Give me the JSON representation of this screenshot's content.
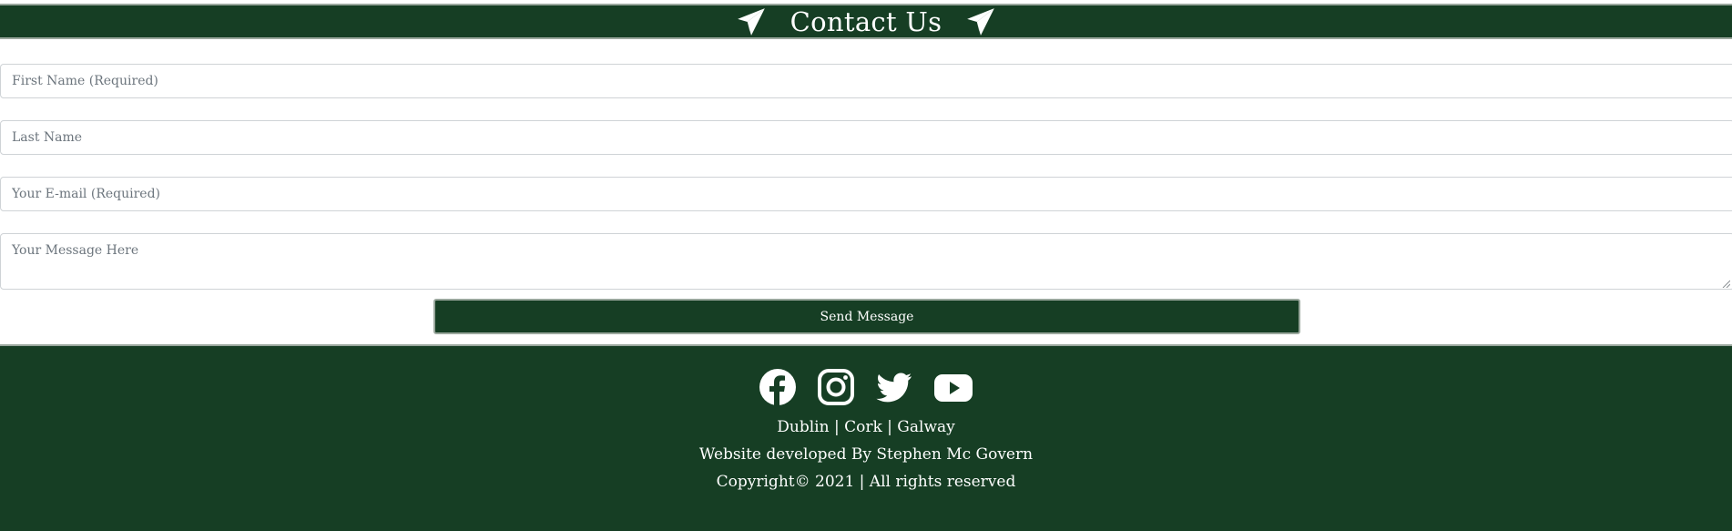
{
  "header": {
    "title": "Contact Us",
    "icons": [
      "paper-plane-icon",
      "paper-plane-icon"
    ]
  },
  "form": {
    "first_name_placeholder": "First Name (Required)",
    "last_name_placeholder": "Last Name",
    "email_placeholder": "Your E-mail (Required)",
    "message_placeholder": "Your Message Here",
    "send_label": "Send Message"
  },
  "footer": {
    "social_icons": [
      "facebook-icon",
      "instagram-icon",
      "twitter-icon",
      "youtube-icon"
    ],
    "cities": "Dublin | Cork | Galway",
    "developer": "Website developed By Stephen Mc Govern",
    "copyright": "Copyright© 2021 | All rights reserved"
  },
  "colors": {
    "brand_green": "#163e24",
    "border_grey": "#9aa79d",
    "text_white": "#ffffff",
    "placeholder_grey": "#6c757d"
  }
}
